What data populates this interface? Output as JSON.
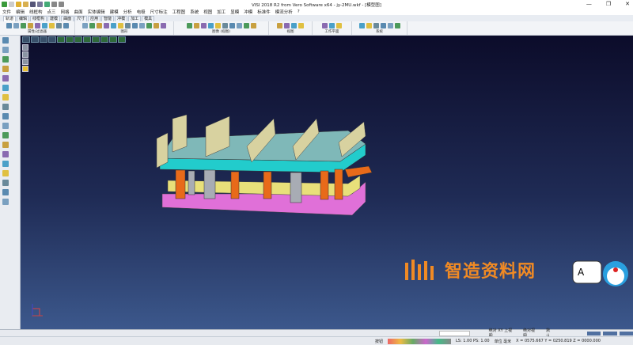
{
  "window": {
    "title": "VISI 2018 R2 from Vero Software x64 - jy-2MU.wkf - [模型图]",
    "minimize": "—",
    "restore": "❐",
    "close": "✕"
  },
  "menu": [
    "文件",
    "编辑",
    "线框构",
    "点三",
    "网格",
    "曲面",
    "实体编辑",
    "建模",
    "分析",
    "电极",
    "尺寸标注",
    "工程图",
    "系统",
    "视图",
    "加工",
    "显模",
    "冲模",
    "标准件",
    "模流分析",
    "?"
  ],
  "tabs": [
    {
      "label": "轨道",
      "active": true
    },
    {
      "label": "编辑"
    },
    {
      "label": "线框构"
    },
    {
      "label": "建模"
    },
    {
      "label": "曲面"
    },
    {
      "label": "尺寸"
    },
    {
      "label": "应用"
    },
    {
      "label": "智能"
    },
    {
      "label": "冲模"
    },
    {
      "label": "加工"
    },
    {
      "label": "模具"
    }
  ],
  "ribbon_groups": [
    {
      "label": "属性/过滤器",
      "icons": 9
    },
    {
      "label": "图形",
      "icons": 12
    },
    {
      "label": "图像 (视图)",
      "icons": 10
    },
    {
      "label": "视图",
      "icons": 4
    },
    {
      "label": "工作平面",
      "icons": 3
    },
    {
      "label": "系统",
      "icons": 6
    }
  ],
  "watermark": {
    "text": "智造资料网",
    "color": "#f08a24"
  },
  "status1": {
    "view_name": "绝对 XY 上视图",
    "abs_view": "绝对视图",
    "default": "默认"
  },
  "status2": {
    "mode": "按钮",
    "ls_ps": "LS: 1.00 PS: 1.00",
    "units": "单位 毫米",
    "coords": "X = 0575.667 Y = 0250.819 Z = 0000.000"
  },
  "colors": {
    "cyan_plate": "#22cccc",
    "pink_plate": "#e070d8",
    "yellow_plate": "#e8e07a",
    "orange_post": "#e86a1a",
    "beige_block": "#d8d2a0"
  }
}
